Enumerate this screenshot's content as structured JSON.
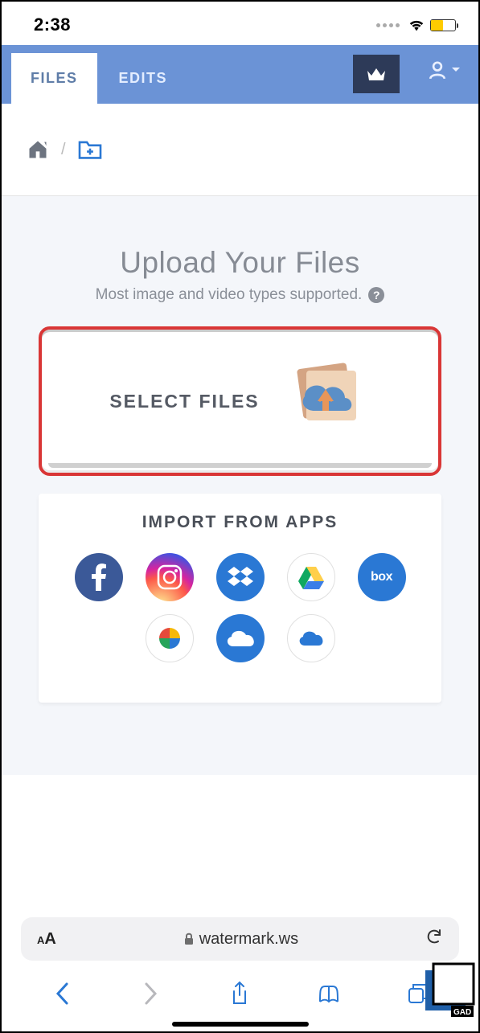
{
  "status": {
    "time": "2:38"
  },
  "tabs": {
    "files": "FILES",
    "edits": "EDITS"
  },
  "upload": {
    "title": "Upload Your Files",
    "subtitle": "Most image and video types supported.",
    "select_label": "SELECT FILES",
    "import_title": "IMPORT FROM APPS",
    "apps_row1": [
      "facebook",
      "instagram",
      "dropbox",
      "google-drive",
      "box"
    ],
    "apps_row2": [
      "google-photos",
      "onedrive",
      "onedrive-alt"
    ],
    "box_label": "box"
  },
  "safari": {
    "url": "watermark.ws"
  }
}
